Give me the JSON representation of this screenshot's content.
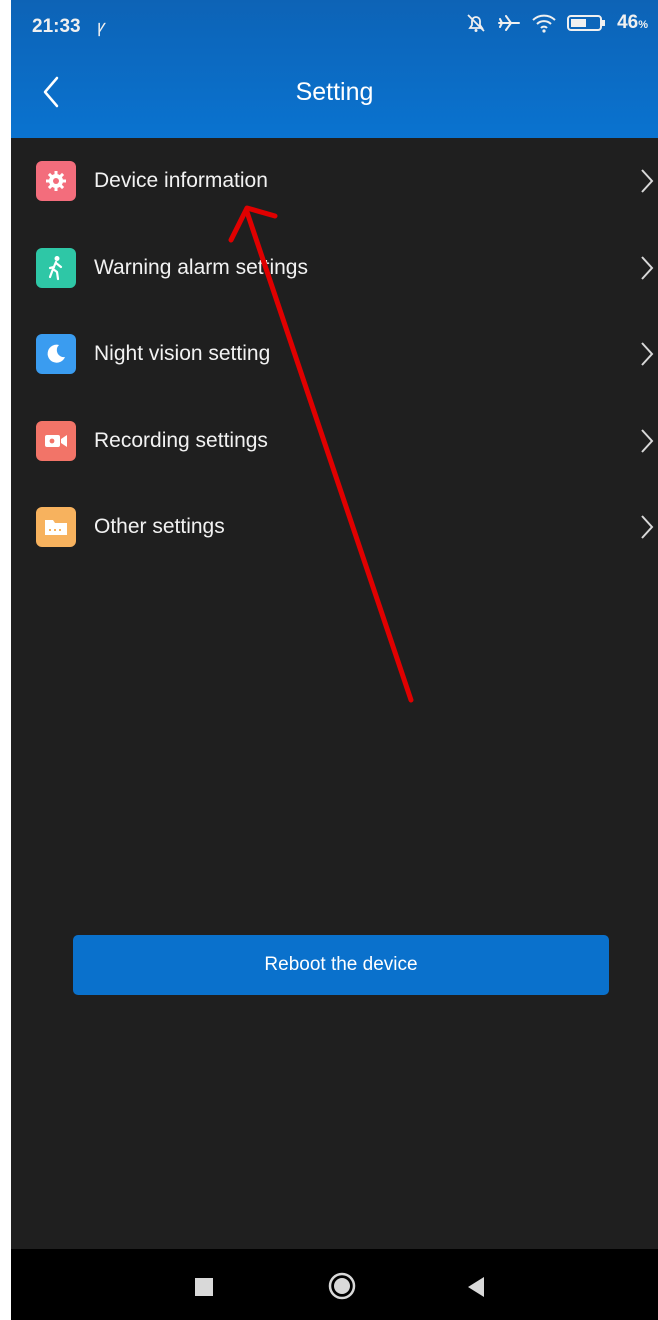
{
  "status_bar": {
    "time": "21:33",
    "battery_level": "46",
    "battery_unit": "%"
  },
  "header": {
    "title": "Setting"
  },
  "menu": {
    "items": [
      {
        "label": "Device information",
        "icon": "gear-icon",
        "color": "#f36d7c"
      },
      {
        "label": "Warning alarm settings",
        "icon": "walking-person-icon",
        "color": "#2ec7a6"
      },
      {
        "label": "Night vision setting",
        "icon": "moon-icon",
        "color": "#3a9cf0"
      },
      {
        "label": "Recording settings",
        "icon": "video-camera-icon",
        "color": "#f27468"
      },
      {
        "label": "Other settings",
        "icon": "folder-icon",
        "color": "#f7b25e"
      }
    ]
  },
  "reboot_button": {
    "label": "Reboot the device"
  },
  "colors": {
    "header": "#0a6bc4",
    "background": "#1f1f1f",
    "button": "#0a71cc",
    "annotation_arrow": "#e00000"
  }
}
